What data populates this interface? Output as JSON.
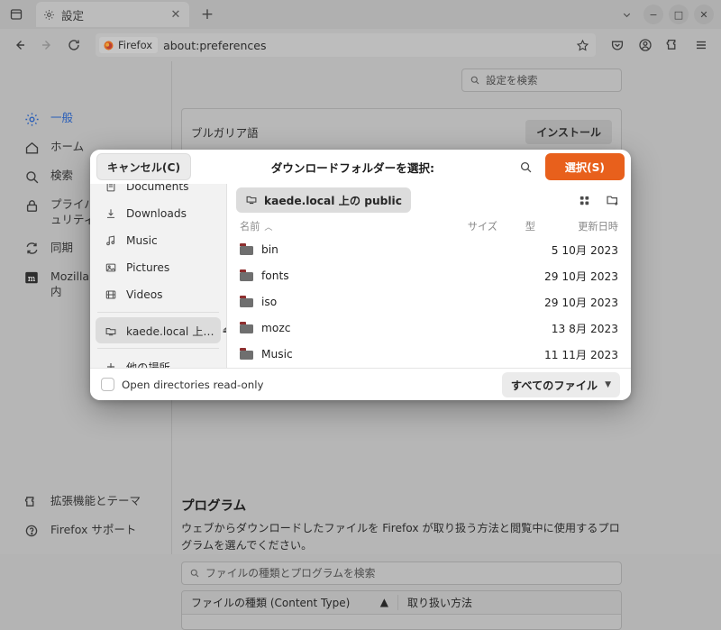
{
  "browser": {
    "tab": {
      "title": "設定",
      "favicon_icon": "gear-icon",
      "close_icon": "close-icon"
    },
    "new_tab_label": "+",
    "list_all_tabs_icon": "list-all-tabs-icon",
    "window_controls": {
      "chevron": "chevron-down-icon",
      "minimize": "−",
      "maximize": "□",
      "close": "✕"
    },
    "nav": {
      "back_icon": "back-arrow-icon",
      "forward_icon": "forward-arrow-icon",
      "reload_icon": "reload-icon",
      "identity_label": "Firefox",
      "url": "about:preferences",
      "bookmark_icon": "star-icon",
      "pocket_icon": "pocket-icon",
      "account_icon": "account-icon",
      "extensions_icon": "extensions-icon",
      "menu_icon": "hamburger-menu-icon"
    }
  },
  "preferences": {
    "search_placeholder": "設定を検索",
    "sidebar": [
      {
        "label": "一般",
        "icon": "gear-icon",
        "active": true
      },
      {
        "label": "ホーム",
        "icon": "home-icon",
        "active": false
      },
      {
        "label": "検索",
        "icon": "search-icon",
        "active": false
      },
      {
        "label": "プライバシーとセキュリティ",
        "icon": "lock-icon",
        "active": false
      },
      {
        "label": "同期",
        "icon": "sync-icon",
        "active": false
      },
      {
        "label": "Mozilla アカウント案内",
        "icon": "mozilla-icon",
        "active": false
      }
    ],
    "sidebar_bottom": [
      {
        "label": "拡張機能とテーマ",
        "icon": "extensions-icon"
      },
      {
        "label": "Firefox サポート",
        "icon": "help-icon"
      }
    ],
    "language_rows": [
      {
        "name": "ブルガリア語",
        "button": "インストール"
      }
    ],
    "programs": {
      "title": "プログラム",
      "description": "ウェブからダウンロードしたファイルを Firefox が取り扱う方法と閲覧中に使用するプログラムを選んでください。",
      "search_placeholder": "ファイルの種類とプログラムを検索",
      "columns": {
        "content_type": "ファイルの種類 (Content Type)",
        "sort_icon": "sort-ascending-icon",
        "action": "取り扱い方法"
      }
    }
  },
  "dialog": {
    "cancel_label": "キャンセル(C)",
    "title": "ダウンロードフォルダーを選択:",
    "search_icon": "search-icon",
    "select_label": "選択(S)",
    "places": [
      {
        "label": "Documents",
        "icon": "document-icon",
        "selected": false,
        "clipped": true
      },
      {
        "label": "Downloads",
        "icon": "download-icon",
        "selected": false
      },
      {
        "label": "Music",
        "icon": "music-note-icon",
        "selected": false
      },
      {
        "label": "Pictures",
        "icon": "image-icon",
        "selected": false
      },
      {
        "label": "Videos",
        "icon": "video-icon",
        "selected": false
      }
    ],
    "places_mounted": [
      {
        "label": "kaede.local 上…",
        "icon": "network-folder-icon",
        "selected": true,
        "eject_icon": "eject-icon"
      }
    ],
    "places_other": [
      {
        "label": "他の場所",
        "icon": "plus-icon"
      }
    ],
    "path_chip": {
      "label": "kaede.local 上の public",
      "icon": "network-folder-icon"
    },
    "view_grid_icon": "grid-view-icon",
    "new_folder_icon": "new-folder-icon",
    "columns": {
      "name": "名前",
      "sort_icon": "sort-ascending-icon",
      "size": "サイズ",
      "type": "型",
      "modified": "更新日時"
    },
    "files": [
      {
        "name": "bin",
        "icon": "folder-icon",
        "size": "",
        "type": "",
        "modified": "5 10月 2023"
      },
      {
        "name": "fonts",
        "icon": "folder-icon",
        "size": "",
        "type": "",
        "modified": "29 10月 2023"
      },
      {
        "name": "iso",
        "icon": "folder-icon",
        "size": "",
        "type": "",
        "modified": "29 10月 2023"
      },
      {
        "name": "mozc",
        "icon": "folder-icon",
        "size": "",
        "type": "",
        "modified": "13 8月 2023"
      },
      {
        "name": "Music",
        "icon": "folder-icon",
        "size": "",
        "type": "",
        "modified": "11 11月 2023"
      }
    ],
    "readonly_label": "Open directories read-only",
    "readonly_checked": false,
    "filter_label": "すべてのファイル",
    "filter_chevron_icon": "chevron-down-icon"
  },
  "colors": {
    "accent_orange": "#e8601c",
    "link_blue": "#2b5fb8",
    "dialog_bg": "#ffffff",
    "places_bg": "#f2f2f2"
  }
}
